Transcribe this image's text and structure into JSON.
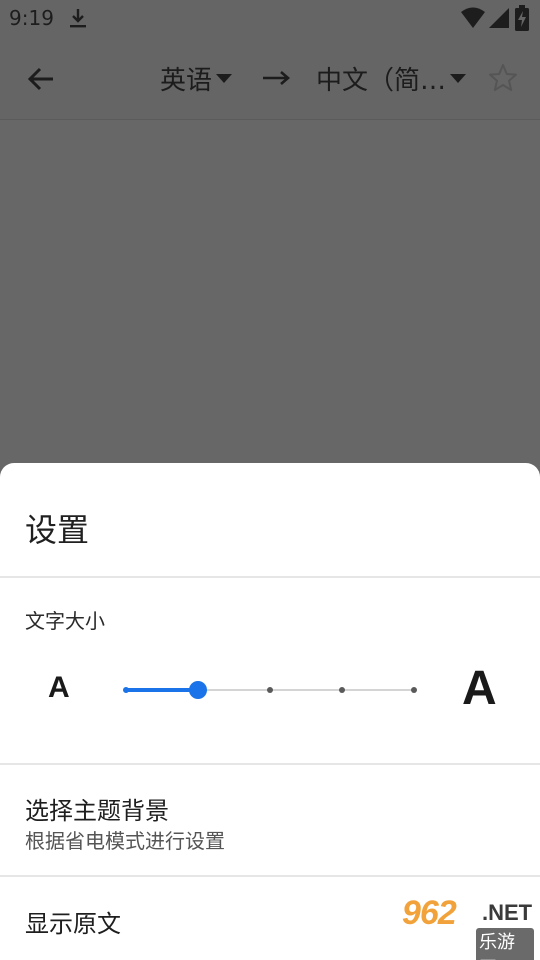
{
  "status_bar": {
    "time": "9:19",
    "download_icon": "download-icon",
    "wifi_icon": "wifi-icon",
    "signal_icon": "signal-icon",
    "battery_icon": "battery-charging-icon"
  },
  "toolbar": {
    "back_icon": "arrow-back-icon",
    "source_language": "英语",
    "direction_icon": "arrow-right-icon",
    "target_language": "中文（简…",
    "favorite_icon": "star-outline-icon"
  },
  "settings_sheet": {
    "title": "设置",
    "text_size": {
      "label": "文字大小",
      "small_glyph": "A",
      "large_glyph": "A",
      "steps": 5,
      "selected_step": 2
    },
    "theme": {
      "title": "选择主题背景",
      "subtitle": "根据省电模式进行设置"
    },
    "show_original": {
      "title": "显示原文"
    }
  },
  "watermark": {
    "main": "962",
    "suffix": ".NET",
    "subtitle": "乐游网"
  },
  "colors": {
    "accent": "#1a73e8",
    "scrim": "#676767",
    "sheet": "#ffffff",
    "watermark_orange": "#f2a23a"
  }
}
